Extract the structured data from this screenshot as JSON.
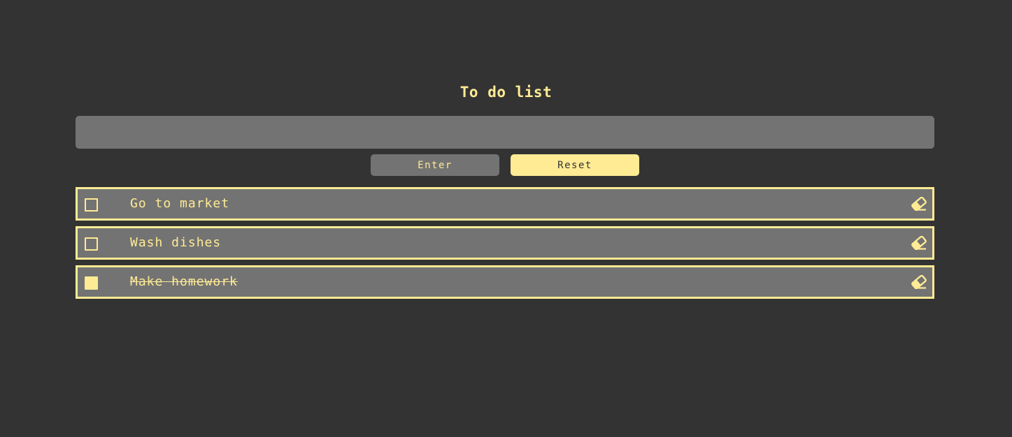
{
  "app": {
    "title": "To do list"
  },
  "input": {
    "value": "",
    "placeholder": ""
  },
  "buttons": {
    "enter_label": "Enter",
    "reset_label": "Reset"
  },
  "tasks": [
    {
      "text": "Go to market",
      "done": false
    },
    {
      "text": "Wash dishes",
      "done": false
    },
    {
      "text": "Make homework",
      "done": true
    }
  ],
  "icons": {
    "delete": "eraser-icon",
    "checkbox": "checkbox-icon"
  },
  "colors": {
    "background": "#333333",
    "surface": "#737373",
    "accent": "#ffeb94"
  }
}
